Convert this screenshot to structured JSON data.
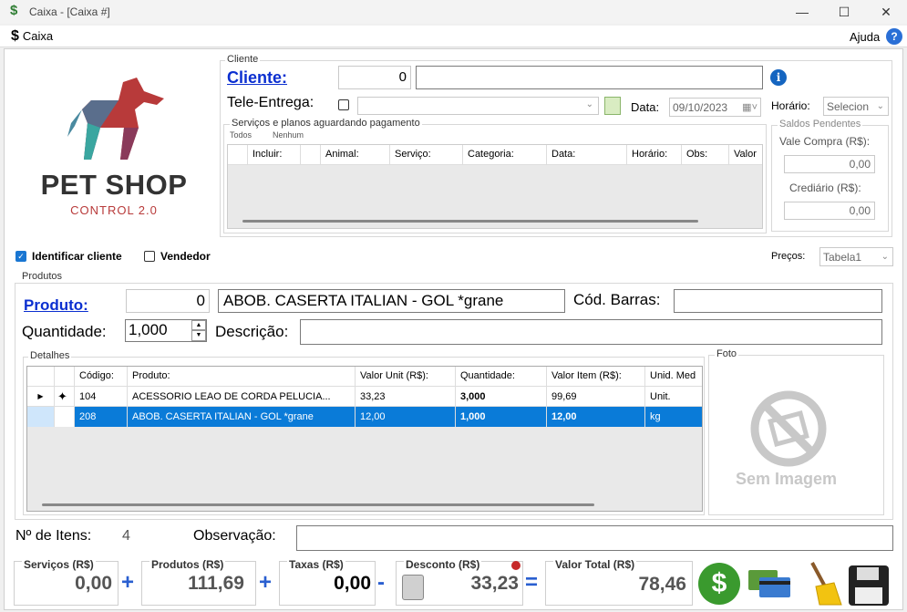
{
  "window": {
    "title": "Caixa - [Caixa #]",
    "icon": "$"
  },
  "menu": {
    "caixa": "Caixa",
    "caixa_icon": "$",
    "ajuda": "Ajuda",
    "help_icon": "?"
  },
  "logo": {
    "line1": "PET SHOP",
    "line2": "CONTROL 2.0"
  },
  "cliente": {
    "group_label": "Cliente",
    "link": "Cliente:",
    "code": "0",
    "name": "",
    "tele_entrega_label": "Tele-Entrega:",
    "tele_value": "",
    "data_label": "Data:",
    "data_value": "09/10/2023",
    "horario_label": "Horário:",
    "horario_value": "Selecion"
  },
  "servicos": {
    "group_label": "Serviços e planos aguardando pagamento",
    "todos": "Todos",
    "nenhum": "Nenhum",
    "columns": [
      "Incluir:",
      "Animal:",
      "Serviço:",
      "Categoria:",
      "Data:",
      "Horário:",
      "Obs:",
      "Valor"
    ]
  },
  "saldos": {
    "group_label": "Saldos Pendentes",
    "vale_label": "Vale Compra (R$):",
    "vale_value": "0,00",
    "crediario_label": "Crediário (R$):",
    "crediario_value": "0,00"
  },
  "options": {
    "identificar": "Identificar cliente",
    "vendedor": "Vendedor",
    "precos_label": "Preços:",
    "precos_value": "Tabela1"
  },
  "produtos": {
    "group_label": "Produtos",
    "link": "Produto:",
    "code": "0",
    "name": "ABOB. CASERTA ITALIAN - GOL *grane",
    "barras_label": "Cód. Barras:",
    "barras_value": "",
    "quantidade_label": "Quantidade:",
    "quantidade_value": "1,000",
    "descricao_label": "Descrição:",
    "descricao_value": ""
  },
  "detalhes": {
    "group_label": "Detalhes",
    "columns": [
      "Código:",
      "Produto:",
      "Valor Unit (R$):",
      "Quantidade:",
      "Valor Item (R$):",
      "Unid. Med"
    ],
    "rows": [
      {
        "codigo": "104",
        "produto": "ACESSORIO LEAO DE CORDA PELUCIA...",
        "valor_unit": "33,23",
        "quantidade": "3,000",
        "valor_item": "99,69",
        "unid": "Unit."
      },
      {
        "codigo": "208",
        "produto": "ABOB. CASERTA ITALIAN - GOL *grane",
        "valor_unit": "12,00",
        "quantidade": "1,000",
        "valor_item": "12,00",
        "unid": "kg"
      }
    ]
  },
  "foto": {
    "group_label": "Foto",
    "placeholder": "Sem Imagem"
  },
  "footer": {
    "itens_label": "Nº de Itens:",
    "itens_value": "4",
    "obs_label": "Observação:",
    "obs_value": ""
  },
  "totals": {
    "servicos_label": "Serviços (R$)",
    "servicos_value": "0,00",
    "produtos_label": "Produtos (R$)",
    "produtos_value": "111,69",
    "taxas_label": "Taxas (R$)",
    "taxas_value": "0,00",
    "desconto_label": "Desconto (R$)",
    "desconto_value": "33,23",
    "total_label": "Valor Total (R$)",
    "total_value": "78,46",
    "plus": "+",
    "minus": "-",
    "equals": "="
  },
  "colors": {
    "accent": "#0a7bd8",
    "link": "#0b2fd0",
    "money_green": "#3a9a2e"
  }
}
